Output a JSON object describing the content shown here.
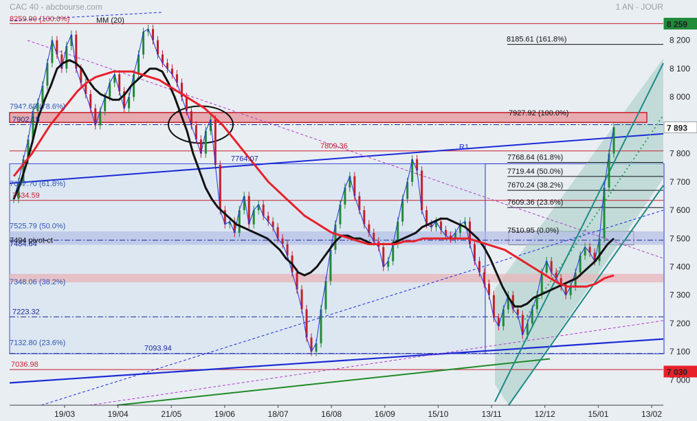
{
  "header": {
    "title": "CAC 40 - abcbourse.com",
    "period": "1 AN - JOUR"
  },
  "chart_data": {
    "type": "candlestick",
    "title": "CAC 40 - abcbourse.com",
    "ylim": [
      7030,
      8260
    ],
    "grid": false,
    "x_ticks": [
      "19/03",
      "19/04",
      "21/05",
      "19/06",
      "18/07",
      "16/08",
      "16/09",
      "15/10",
      "13/11",
      "12/12",
      "15/01",
      "13/02"
    ],
    "y_ticks": [
      "7 000",
      "7 100",
      "7 200",
      "7 300",
      "7 400",
      "7 500",
      "7 600",
      "7 700",
      "7 800",
      "7 900",
      "8 000",
      "8 100",
      "8 200"
    ],
    "price_badges": [
      {
        "label": "8 259",
        "value": 8259,
        "color": "#1f8a3a"
      },
      {
        "label": "7 893",
        "value": 7893,
        "color": "#ffffff"
      },
      {
        "label": "7 030",
        "value": 7030,
        "color": "#e8202a"
      }
    ],
    "moving_average_label": "MM (20)",
    "close_series": [
      7640,
      7700,
      7780,
      7850,
      7950,
      7980,
      8040,
      8120,
      8200,
      8150,
      8100,
      8180,
      8220,
      8100,
      8050,
      8010,
      7960,
      7900,
      7950,
      8000,
      8050,
      8080,
      8020,
      7960,
      8000,
      8080,
      8150,
      8230,
      8240,
      8200,
      8150,
      8120,
      8100,
      8080,
      8050,
      8000,
      7950,
      7900,
      7850,
      7800,
      7880,
      7920,
      7760,
      7600,
      7550,
      7560,
      7520,
      7600,
      7650,
      7550,
      7600,
      7620,
      7580,
      7560,
      7540,
      7500,
      7480,
      7440,
      7380,
      7320,
      7250,
      7150,
      7100,
      7130,
      7250,
      7350,
      7460,
      7550,
      7620,
      7680,
      7720,
      7650,
      7600,
      7550,
      7520,
      7490,
      7470,
      7400,
      7420,
      7480,
      7560,
      7640,
      7700,
      7780,
      7740,
      7600,
      7550,
      7540,
      7560,
      7530,
      7510,
      7500,
      7520,
      7550,
      7560,
      7480,
      7420,
      7380,
      7340,
      7300,
      7220,
      7190,
      7250,
      7300,
      7250,
      7230,
      7160,
      7200,
      7250,
      7300,
      7380,
      7420,
      7380,
      7360,
      7330,
      7300,
      7330,
      7380,
      7440,
      7470,
      7450,
      7420,
      7500,
      7680,
      7800,
      7893
    ],
    "moving_averages": [
      {
        "name": "MM (20)",
        "color": "#111111",
        "values": [
          7640,
          7690,
          7760,
          7840,
          7930,
          7990,
          8040,
          8100,
          8120,
          8130,
          8120,
          8100,
          8060,
          8030,
          8010,
          8000,
          7990,
          7990,
          8010,
          8040,
          8060,
          8080,
          8100,
          8100,
          8090,
          8050,
          8000,
          7940,
          7880,
          7800,
          7740,
          7680,
          7640,
          7610,
          7590,
          7570,
          7550,
          7540,
          7530,
          7520,
          7510,
          7500,
          7480,
          7460,
          7430,
          7410,
          7380,
          7370,
          7380,
          7400,
          7430,
          7460,
          7490,
          7510,
          7510,
          7500,
          7500,
          7490,
          7480,
          7480,
          7480,
          7480,
          7490,
          7500,
          7510,
          7520,
          7540,
          7550,
          7560,
          7570,
          7570,
          7560,
          7550,
          7540,
          7520,
          7500,
          7470,
          7430,
          7380,
          7330,
          7290,
          7260,
          7260,
          7270,
          7290,
          7300,
          7310,
          7320,
          7330,
          7340,
          7350,
          7360,
          7380,
          7400,
          7420,
          7450,
          7480,
          7500
        ]
      },
      {
        "name": "",
        "color": "#e8202a",
        "values": [
          7720,
          7760,
          7800,
          7850,
          7900,
          7940,
          7980,
          8020,
          8050,
          8070,
          8080,
          8090,
          8090,
          8090,
          8080,
          8070,
          8060,
          8040,
          8020,
          8000,
          7980,
          7960,
          7930,
          7900,
          7860,
          7820,
          7780,
          7740,
          7700,
          7670,
          7640,
          7610,
          7580,
          7560,
          7540,
          7520,
          7510,
          7500,
          7490,
          7480,
          7480,
          7480,
          7480,
          7490,
          7490,
          7500,
          7500,
          7500,
          7500,
          7500,
          7500,
          7490,
          7480,
          7470,
          7460,
          7440,
          7420,
          7400,
          7380,
          7360,
          7340,
          7330,
          7330,
          7330,
          7340,
          7360,
          7370
        ]
      }
    ],
    "horizontal_levels": [
      {
        "label": "8185.61  (161.8%)",
        "value": 8185.61
      },
      {
        "label": "7927.92  (100.0%)",
        "value": 7927.92
      },
      {
        "label": "7768.64  (61.8%)",
        "value": 7768.64
      },
      {
        "label": "7719.44  (50.0%)",
        "value": 7719.44
      },
      {
        "label": "7670.24  (38.2%)",
        "value": 7670.24
      },
      {
        "label": "7609.36  (23.6%)",
        "value": 7609.36
      },
      {
        "label": "7510.95  (0.0%)",
        "value": 7510.95
      },
      {
        "label": "7809.36",
        "value": 7809.36
      },
      {
        "label": "7764.07",
        "value": 7764.07
      },
      {
        "label": "7902.15",
        "value": 7902.15
      },
      {
        "label": "794?.68  (78.6%)",
        "value": 7945.68
      },
      {
        "label": "769?.?0  (61.8%)",
        "value": 7695.0
      },
      {
        "label": "7634.59",
        "value": 7634.59
      },
      {
        "label": "7525.79  (50.0%)",
        "value": 7525.79
      },
      {
        "label": "7484.64",
        "value": 7484.64
      },
      {
        "label": "7348.06  (38.2%)",
        "value": 7348.06
      },
      {
        "label": "7223.32",
        "value": 7223.32
      },
      {
        "label": "7132.80  (23.6%)",
        "value": 7132.8
      },
      {
        "label": "7093.94",
        "value": 7093.94
      },
      {
        "label": "7036.98",
        "value": 7036.98
      }
    ],
    "pivot_label": "7494 pivot-ct",
    "resistance_label": "R1",
    "top_left_labels": "8259.90 (100.0%)"
  }
}
